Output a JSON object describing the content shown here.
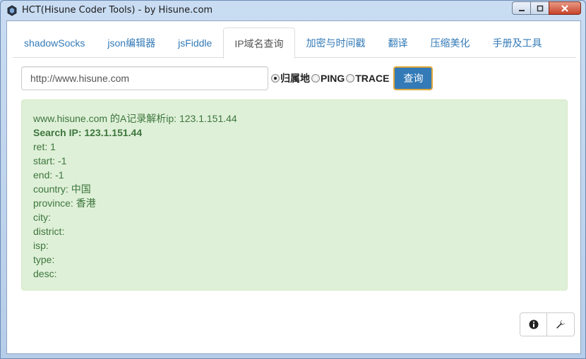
{
  "window": {
    "title": "HCT(Hisune Coder Tools) - by Hisune.com"
  },
  "tabs": [
    {
      "label": "shadowSocks",
      "active": false
    },
    {
      "label": "json编辑器",
      "active": false
    },
    {
      "label": "jsFiddle",
      "active": false
    },
    {
      "label": "IP域名查询",
      "active": true
    },
    {
      "label": "加密与时间戳",
      "active": false
    },
    {
      "label": "翻译",
      "active": false
    },
    {
      "label": "压缩美化",
      "active": false
    },
    {
      "label": "手册及工具",
      "active": false
    }
  ],
  "search": {
    "value": "http://www.hisune.com",
    "options": [
      {
        "label": "归属地",
        "checked": true
      },
      {
        "label": "PING",
        "checked": false
      },
      {
        "label": "TRACE",
        "checked": false
      }
    ],
    "button_label": "查询"
  },
  "result": {
    "lines": [
      "www.hisune.com 的A记录解析ip: 123.1.151.44",
      "Search IP: 123.1.151.44",
      "ret: 1",
      "start: -1",
      "end: -1",
      "country: 中国",
      "province: 香港",
      "city:",
      "district:",
      "isp:",
      "type:",
      "desc:"
    ]
  },
  "footer": {
    "info_icon": "info-icon",
    "tools_icon": "wrench-icon"
  },
  "colors": {
    "accent": "#337ab7",
    "success_bg": "#dff0d8",
    "success_text": "#3c763d"
  }
}
